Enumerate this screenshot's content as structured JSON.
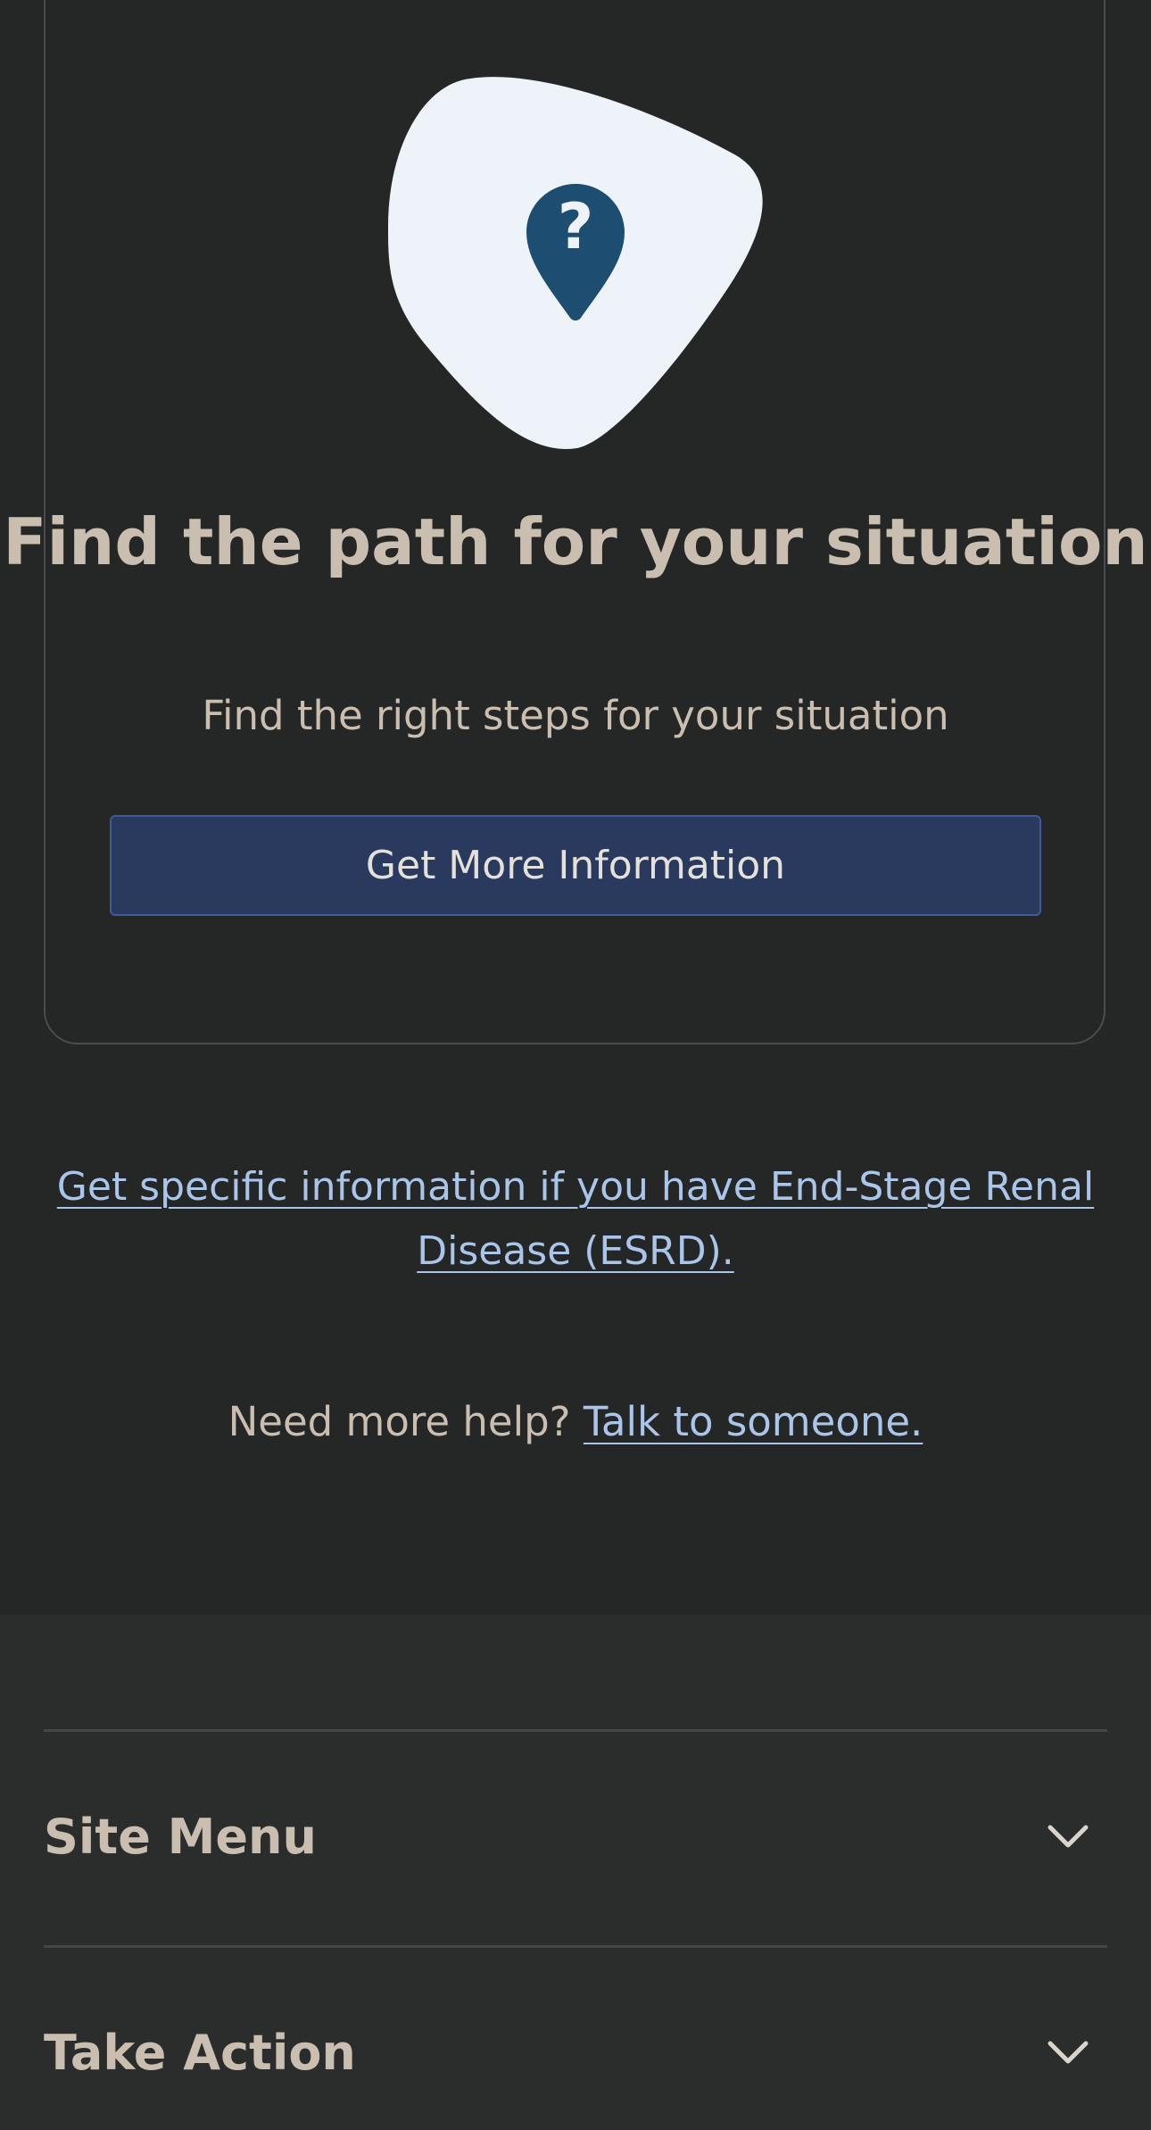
{
  "card": {
    "icon": "question-location-pin-icon",
    "title": "Find the path for your situation",
    "subtitle": "Find the right steps for your situation",
    "button_label": "Get More Information"
  },
  "links": {
    "esrd": "Get specific information if you have End-Stage Renal Disease (ESRD).",
    "help_prefix": "Need more help?",
    "help_link": "Talk to someone."
  },
  "footer": {
    "sections": [
      {
        "label": "Site Menu",
        "icon": "chevron-down-icon"
      },
      {
        "label": "Take Action",
        "icon": "chevron-down-icon"
      }
    ]
  },
  "colors": {
    "background": "#252626",
    "footer_background": "#2b2c2c",
    "text": "#c9beb0",
    "link": "#a9c5ea",
    "button": "#2a3a5e",
    "icon_blob": "#edf3f9",
    "icon_pin": "#1d4e72"
  }
}
